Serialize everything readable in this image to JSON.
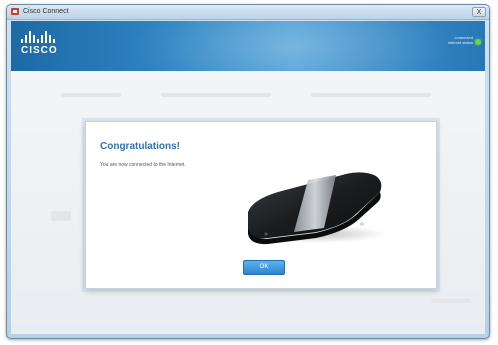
{
  "window": {
    "title": "Cisco Connect",
    "close_label": "X"
  },
  "header": {
    "logo_text": "CISCO",
    "status_line_1": "connected",
    "status_line_2": "internet status",
    "status_color": "#6fd04a"
  },
  "dialog": {
    "title": "Congratulations!",
    "message": "You are now connected to the Internet.",
    "ok_label": "OK"
  },
  "icons": {
    "app": "cisco-app-icon",
    "router": "router-image",
    "status": "status-indicator-icon"
  },
  "colors": {
    "accent": "#2d74b0",
    "header_blue": "#2f86c4",
    "button_blue": "#2c86cf"
  }
}
